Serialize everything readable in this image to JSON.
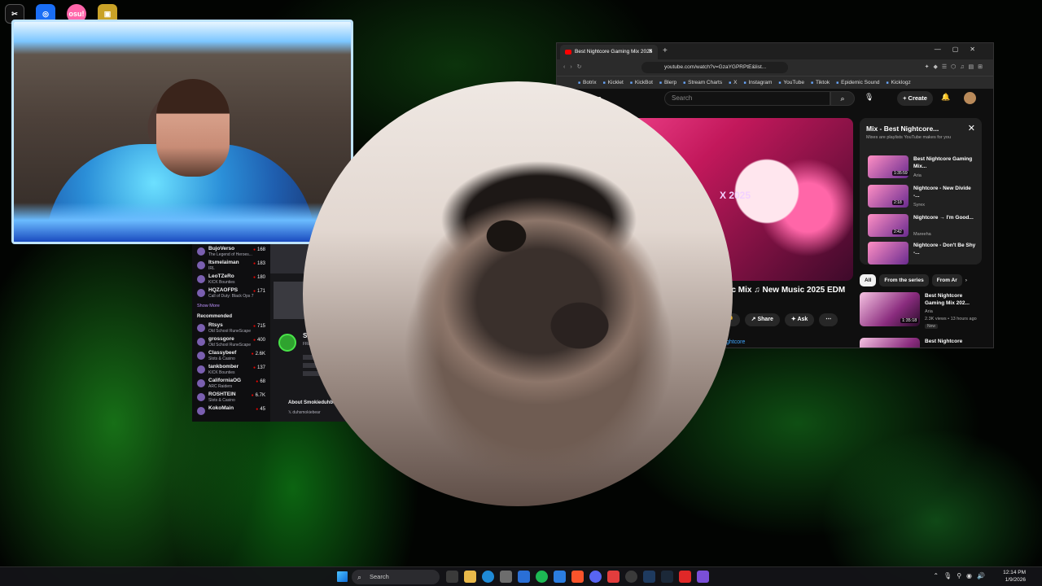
{
  "desktop_icons": [
    {
      "name": "capcut-icon",
      "label": "",
      "color": "#111111"
    },
    {
      "name": "app-icon",
      "label": "",
      "color": "#1a6ef5"
    },
    {
      "name": "osu-icon",
      "label": "osu!",
      "color": "#ff66aa"
    },
    {
      "name": "robot-icon",
      "label": "",
      "color": "#c9a227"
    }
  ],
  "twitch": {
    "followed": [
      {
        "name": "BujoVerso",
        "game": "The Legend of Heroes...",
        "viewers": "168"
      },
      {
        "name": "Itsmelaiman",
        "game": "IRL",
        "viewers": "183"
      },
      {
        "name": "LeoTZeRo",
        "game": "KICK Bounties",
        "viewers": "180"
      },
      {
        "name": "HQZAOFPS",
        "game": "Call of Duty: Black Ops 7",
        "viewers": "171"
      }
    ],
    "show_more": "Show More",
    "recommended_label": "Recommended",
    "recommended": [
      {
        "name": "Rtsys",
        "game": "Old School RuneScape",
        "viewers": "715"
      },
      {
        "name": "grossgore",
        "game": "Old School RuneScape",
        "viewers": "400"
      },
      {
        "name": "Classybeef",
        "game": "Slots & Casino",
        "viewers": "2.6K"
      },
      {
        "name": "tankbomber",
        "game": "KICK Bounties",
        "viewers": "137"
      },
      {
        "name": "CaliforniaOG",
        "game": "ARC Raiders",
        "viewers": "68"
      },
      {
        "name": "ROSHTEIN",
        "game": "Slots & Casino",
        "viewers": "6.7K"
      },
      {
        "name": "KokoMain",
        "game": "",
        "viewers": "45"
      }
    ],
    "channel_name": "Sm",
    "channel_sub": "FRE",
    "about_label": "About Smokieduhbe",
    "social": "duhsmokiebear"
  },
  "browser": {
    "tab_title": "Best Nightcore Gaming Mix 2025",
    "url": "youtube.com/watch?v=GzaYGPRPtE&list...",
    "bookmarks": [
      "Botrix",
      "Kicklet",
      "KickBot",
      "Blerp",
      "Stream Charts",
      "X",
      "Instagram",
      "YouTube",
      "Tiktok",
      "Epidemic Sound",
      "Kicklogz"
    ],
    "logo": "Tube",
    "search_placeholder": "Search",
    "create_label": "Create",
    "video_year": "X 2025",
    "video_title": "usic Mix ♫ New Music 2025 EDM",
    "share_label": "Share",
    "ask_label": "Ask",
    "channel_link": "ghtcore",
    "mix": {
      "title": "Mix - Best Nightcore...",
      "subtitle": "Mixes are playlists YouTube makes for you",
      "items": [
        {
          "title": "Best Nightcore Gaming Mix...",
          "author": "Aria",
          "duration": "1:35:59"
        },
        {
          "title": "Nightcore - New Divide -...",
          "author": "Syrex",
          "duration": "2:18"
        },
        {
          "title": "Nightcore → I'm Good...",
          "author": "Mareeha",
          "duration": "2:42"
        },
        {
          "title": "Nightcore - Don't Be Shy -...",
          "author": "",
          "duration": ""
        }
      ]
    },
    "chips": [
      "All",
      "From the series",
      "From Ar"
    ],
    "recs": [
      {
        "title": "Best Nightcore Gaming Mix 202...",
        "author": "Aria",
        "meta": "2.3K views • 13 hours ago",
        "badge": "New",
        "duration": "1:35:18"
      },
      {
        "title": "Best Nightcore",
        "author": "",
        "meta": "",
        "badge": "",
        "duration": ""
      }
    ]
  },
  "taskbar": {
    "search_label": "Search",
    "time": "12:14 PM",
    "date": "1/9/2026"
  }
}
